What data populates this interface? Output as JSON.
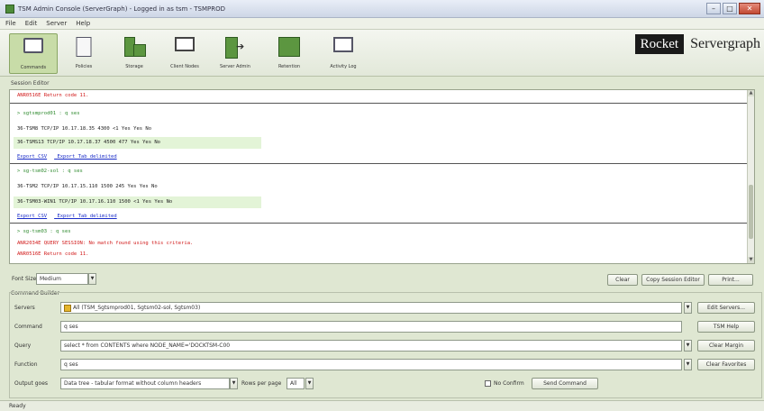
{
  "window": {
    "title": "TSM Admin Console (ServerGraph) - Logged in as tsm - TSMPROD",
    "buttons": {
      "minimize": "–",
      "maximize": "□",
      "close": "✕"
    }
  },
  "menu": [
    "File",
    "Edit",
    "Server",
    "Help"
  ],
  "toolbar": {
    "items": [
      {
        "label": "Commands",
        "icon": "computer-icon"
      },
      {
        "label": "Policies",
        "icon": "document-icon"
      },
      {
        "label": "Storage",
        "icon": "storage-icon"
      },
      {
        "label": "Client Nodes",
        "icon": "monitor-icon"
      },
      {
        "label": "Server Admin",
        "icon": "arrow-box-icon"
      },
      {
        "label": "Retention",
        "icon": "servers-icon"
      },
      {
        "label": "Activity Log",
        "icon": "chart-icon"
      }
    ],
    "brand": {
      "rocket": "Rocket",
      "product": "Servergraph"
    }
  },
  "session": {
    "label": "Session Editor",
    "lines": [
      "ANR0516E Return code 11.",
      "> sgtsmprod01 : q ses",
      "36-TSM8   TCP/IP 10.17.18.35 4300 <1  Yes Yes No",
      "36-TSMS13 TCP/IP 10.17.18.37 4500 477 Yes Yes No",
      "> sg-tsm02-sol : q ses",
      "36-TSM2        TCP/IP 10.17.15.110 1500 245 Yes Yes No",
      "36-TSM03-WIN1 TCP/IP 10.17.16.110 1500 <1  Yes Yes No",
      "> sg-tsm03 : q ses",
      "ANR2034E QUERY SESSION: No match found using this criteria.",
      "ANR0516E Return code 11."
    ],
    "links": {
      "export_csv": "Export CSV",
      "export_tab": "Export Tab delimited"
    }
  },
  "font_size": {
    "label": "Font Size",
    "value": "Medium",
    "buttons": [
      "Clear",
      "Copy Session Editor",
      "Print..."
    ]
  },
  "builder": {
    "label": "Command Builder",
    "servers_label": "Servers",
    "servers_value": "All (TSM_Sgtsmprod01, Sgtsm02-sol, Sgtsm03)",
    "command_label": "Command",
    "command_value": "q ses",
    "query_label": "Query",
    "query_value": "select * from CONTENTS where NODE_NAME='DOCKTSM-C00",
    "function_label": "Function",
    "function_value": "q ses",
    "output_label": "Output goes",
    "output_value": "Data tree - tabular format without column headers",
    "rows_label": "Rows per page",
    "rows_value": "All",
    "no_confirm": "No Confirm",
    "send_button": "Send Command",
    "side_buttons": [
      "Edit Servers...",
      "TSM Help",
      "Clear Margin",
      "Clear Favorites"
    ]
  },
  "status": {
    "text": "Ready"
  }
}
